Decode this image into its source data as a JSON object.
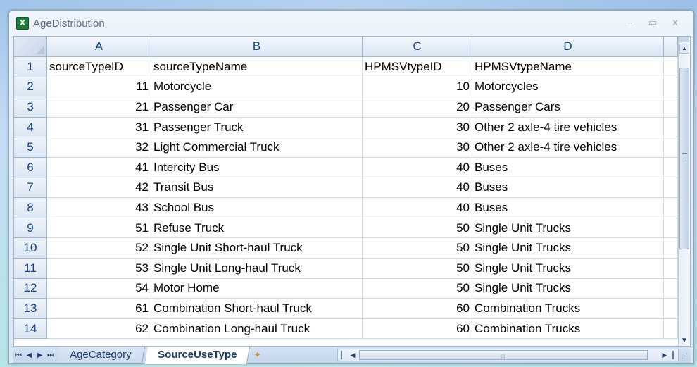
{
  "window": {
    "title": "AgeDistribution",
    "icon": "excel-workbook-icon",
    "controls": {
      "minimize": "–",
      "maximize": "▭",
      "close": "x"
    }
  },
  "sheet": {
    "columns": [
      "A",
      "B",
      "C",
      "D"
    ],
    "rows": [
      {
        "n": "1",
        "a": "sourceTypeID",
        "b": "sourceTypeName",
        "c": "HPMSVtypeID",
        "d": "HPMSVtypeName"
      },
      {
        "n": "2",
        "a": "11",
        "b": "Motorcycle",
        "c": "10",
        "d": "Motorcycles"
      },
      {
        "n": "3",
        "a": "21",
        "b": "Passenger Car",
        "c": "20",
        "d": "Passenger Cars"
      },
      {
        "n": "4",
        "a": "31",
        "b": "Passenger Truck",
        "c": "30",
        "d": "Other 2 axle-4 tire vehicles"
      },
      {
        "n": "5",
        "a": "32",
        "b": "Light Commercial Truck",
        "c": "30",
        "d": "Other 2 axle-4 tire vehicles"
      },
      {
        "n": "6",
        "a": "41",
        "b": "Intercity Bus",
        "c": "40",
        "d": "Buses"
      },
      {
        "n": "7",
        "a": "42",
        "b": "Transit Bus",
        "c": "40",
        "d": "Buses"
      },
      {
        "n": "8",
        "a": "43",
        "b": "School Bus",
        "c": "40",
        "d": "Buses"
      },
      {
        "n": "9",
        "a": "51",
        "b": "Refuse Truck",
        "c": "50",
        "d": "Single Unit Trucks"
      },
      {
        "n": "10",
        "a": "52",
        "b": "Single Unit Short-haul Truck",
        "c": "50",
        "d": "Single Unit Trucks"
      },
      {
        "n": "11",
        "a": "53",
        "b": "Single Unit Long-haul Truck",
        "c": "50",
        "d": "Single Unit Trucks"
      },
      {
        "n": "12",
        "a": "54",
        "b": "Motor Home",
        "c": "50",
        "d": "Single Unit Trucks"
      },
      {
        "n": "13",
        "a": "61",
        "b": "Combination Short-haul Truck",
        "c": "60",
        "d": "Combination Trucks"
      },
      {
        "n": "14",
        "a": "62",
        "b": "Combination Long-haul Truck",
        "c": "60",
        "d": "Combination Trucks"
      }
    ]
  },
  "tabs": {
    "nav": [
      "first-sheet",
      "prev-sheet",
      "next-sheet",
      "last-sheet"
    ],
    "items": [
      {
        "label": "AgeCategory",
        "active": false
      },
      {
        "label": "SourceUseType",
        "active": true
      }
    ],
    "new_sheet_icon": "insert-worksheet-icon"
  },
  "colors": {
    "header_text": "#15428b",
    "grid_line": "#d0d7e5",
    "frame": "#8aa6c7"
  }
}
